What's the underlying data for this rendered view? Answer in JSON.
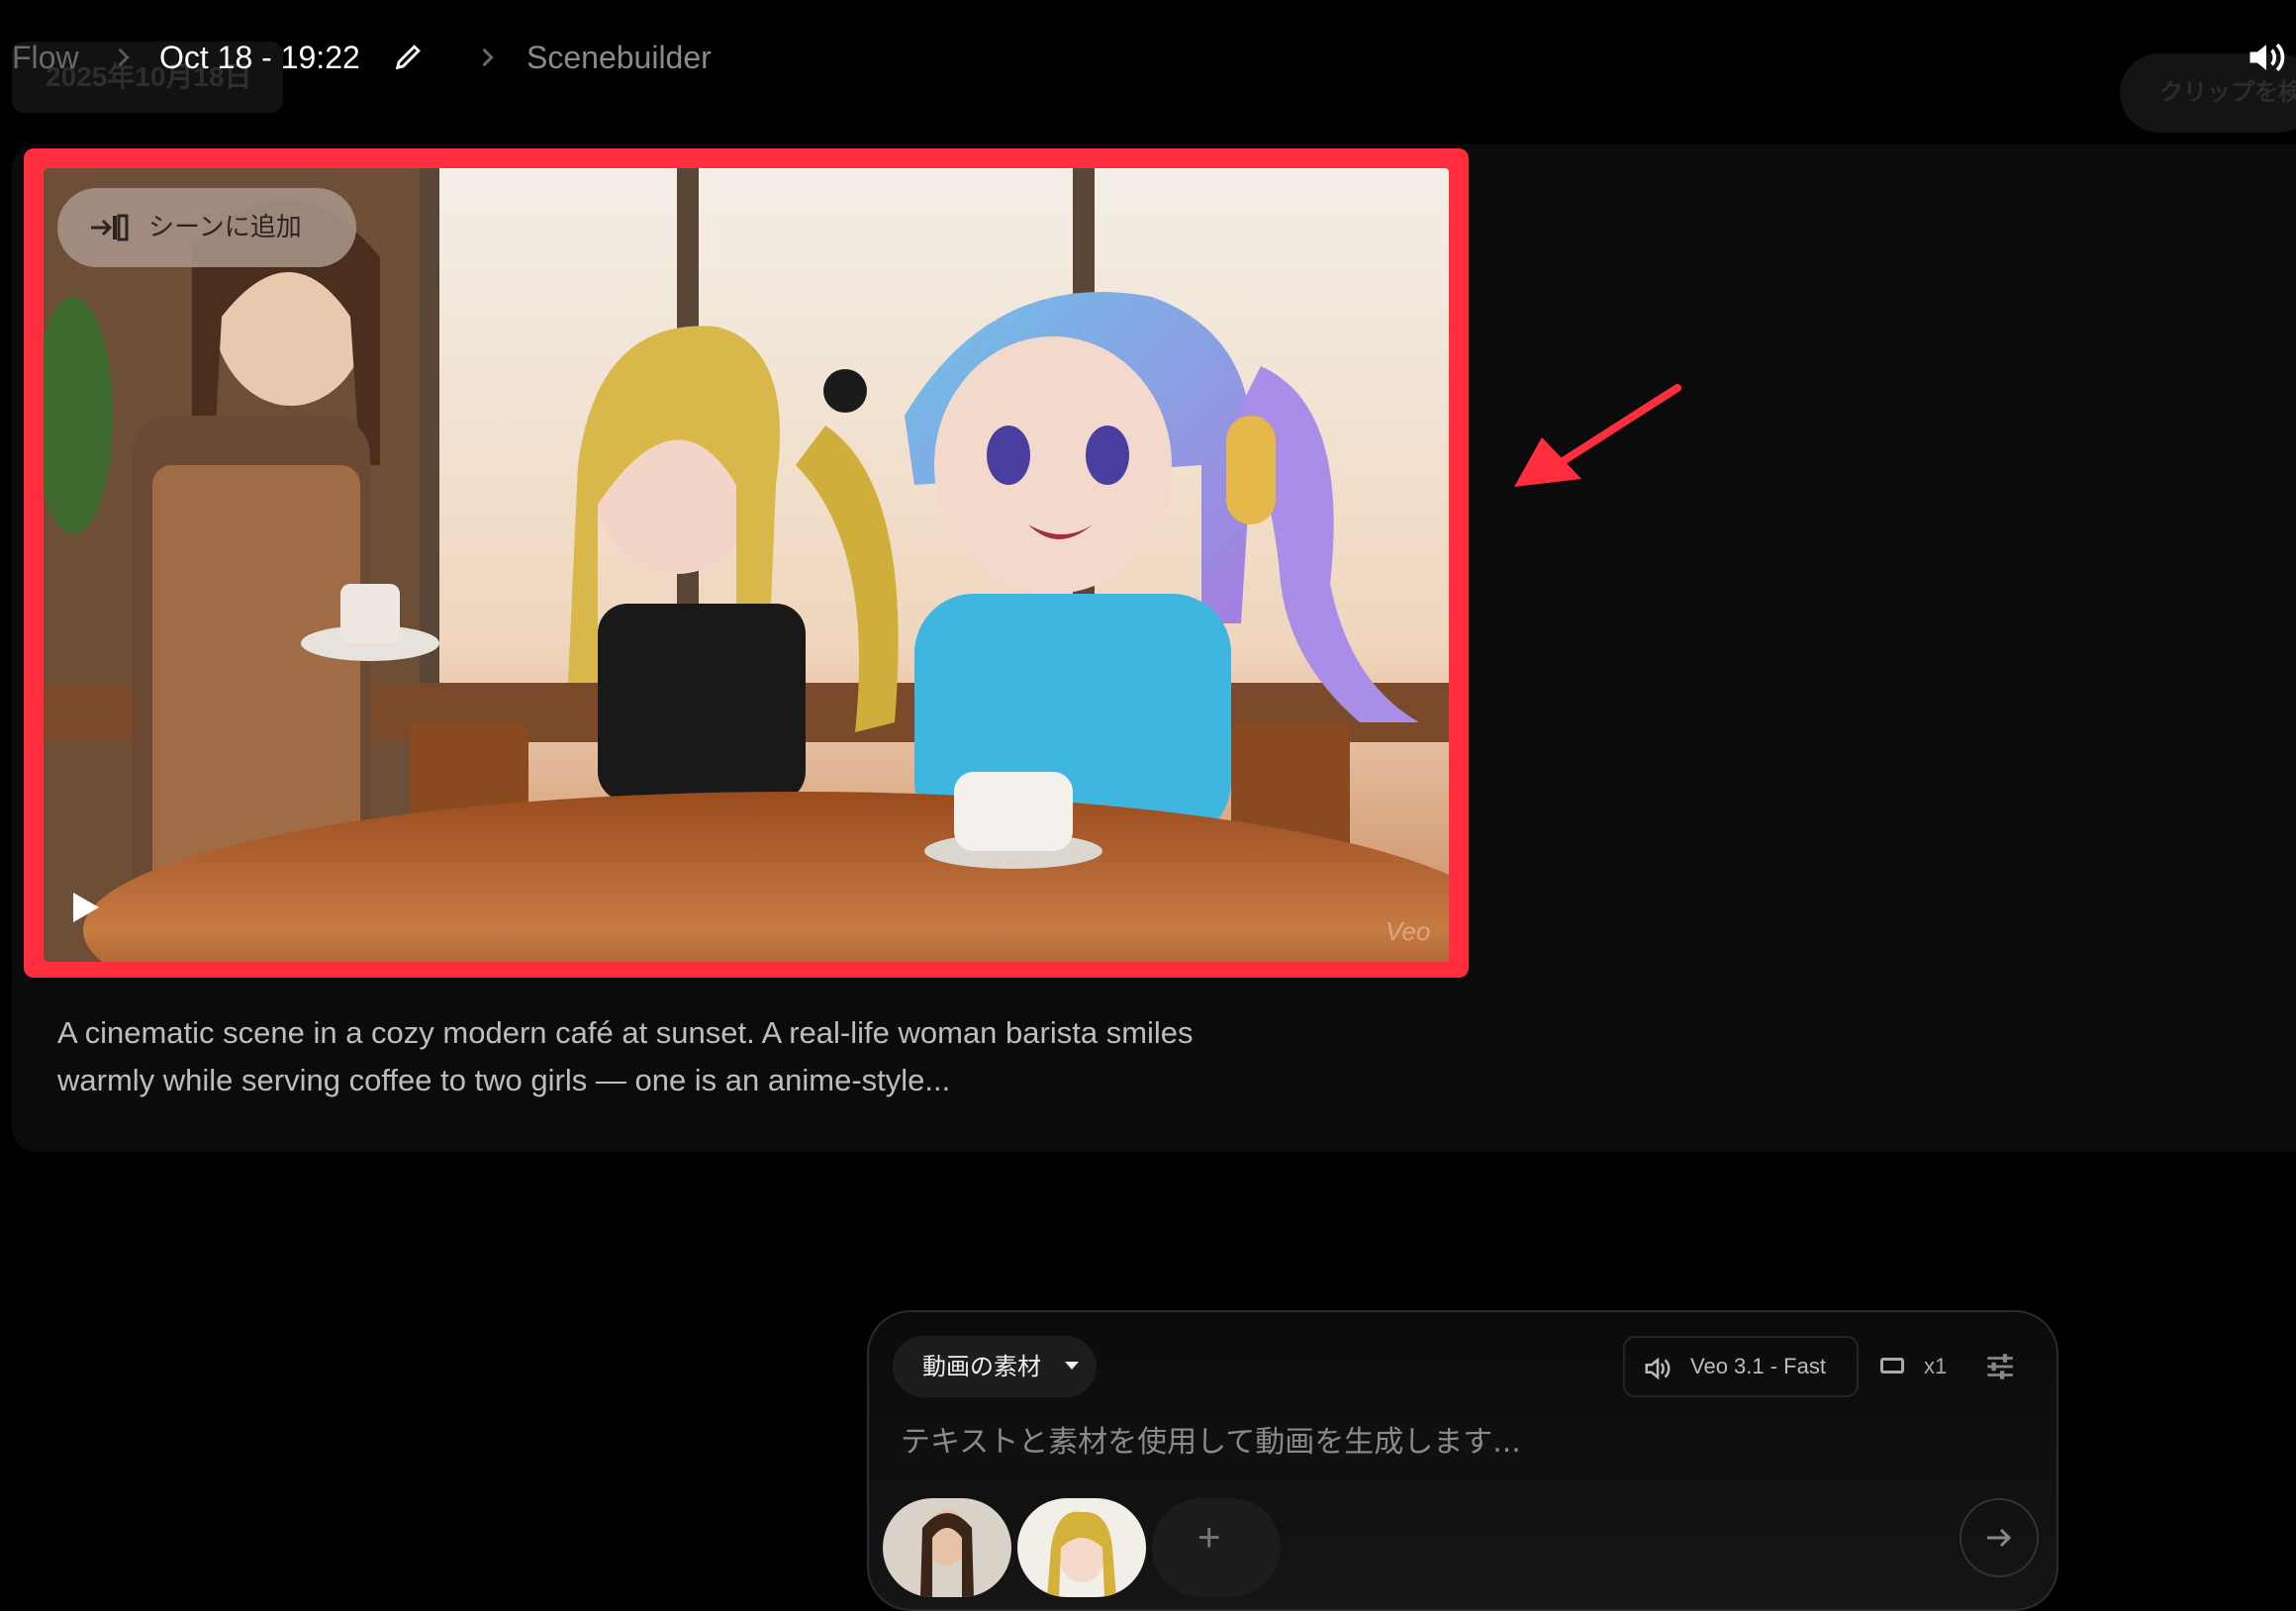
{
  "header": {
    "ghost_date": "2025年10月18日",
    "breadcrumb": [
      "Flow",
      "Oct 18 - 19:22",
      "Scenebuilder"
    ],
    "ghost_clip_button": "クリップを検"
  },
  "video": {
    "add_to_scene_label": "シーンに追加",
    "watermark": "Veo"
  },
  "description": "A cinematic scene in a cozy modern café at sunset. A real-life woman barista smiles warmly while serving coffee to two girls — one is an anime-style...",
  "composer": {
    "asset_dropdown": "動画の素材",
    "model": "Veo 3.1 - Fast",
    "count": "x1",
    "placeholder": "テキストと素材を使用して動画を生成します...",
    "add_asset_symbol": "+"
  },
  "colors": {
    "annotation_red": "#ff2e3e",
    "background": "#000000",
    "card": "#0b0b0b"
  }
}
